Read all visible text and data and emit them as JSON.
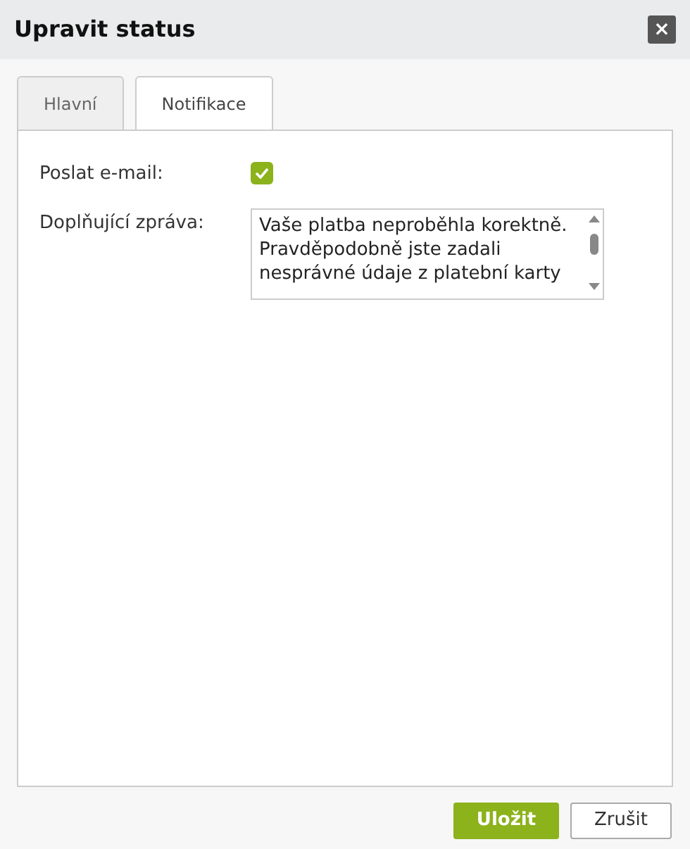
{
  "window": {
    "title": "Upravit status",
    "close": "×"
  },
  "tabs": [
    {
      "label": "Hlavní",
      "selected": false
    },
    {
      "label": "Notifikace",
      "selected": true
    }
  ],
  "fields": [
    {
      "kind": "checkbox",
      "label": "Poslat e-mail:",
      "checked": true
    },
    {
      "kind": "textarea",
      "label": "Doplňující zpráva:",
      "value": "Vaše platba neproběhla korektně. Pravděpodobně jste zadali nesprávné údaje z platební karty"
    }
  ],
  "buttons": [
    {
      "label": "Uložit",
      "kind": "primary"
    },
    {
      "label": "Zrušit",
      "kind": "secondary"
    }
  ]
}
